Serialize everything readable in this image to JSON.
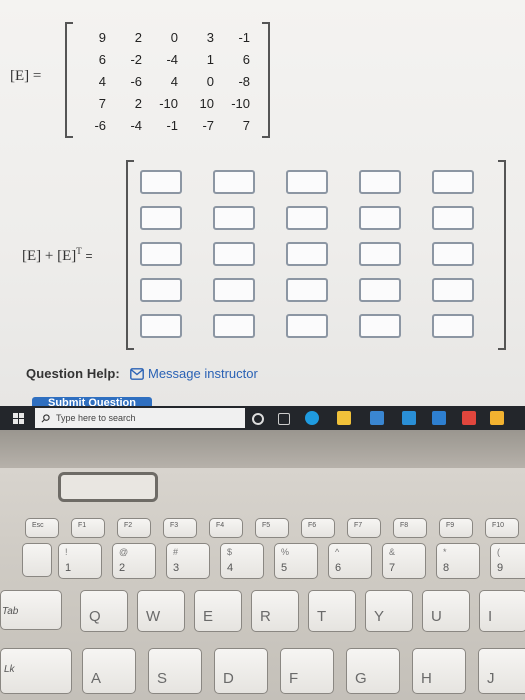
{
  "matrix": {
    "label": "[E] =",
    "rows": [
      [
        "9",
        "2",
        "0",
        "3",
        "-1"
      ],
      [
        "6",
        "-2",
        "-4",
        "1",
        "6"
      ],
      [
        "4",
        "-6",
        "4",
        "0",
        "-8"
      ],
      [
        "7",
        "2",
        "-10",
        "10",
        "-10"
      ],
      [
        "-6",
        "-4",
        "-1",
        "-7",
        "7"
      ]
    ]
  },
  "sum_label": "[E] + [E]",
  "sum_sup": "T",
  "sum_eq": "=",
  "help_label": "Question Help:",
  "message_link": "Message instructor",
  "submit_label": "Submit Question",
  "taskbar": {
    "search_placeholder": "Type here to search"
  },
  "keyboard": {
    "fn_row": [
      "Esc",
      "F1",
      "F2",
      "F3",
      "F4",
      "F5",
      "F6",
      "F7",
      "F8",
      "F9",
      "F10"
    ],
    "num_row": [
      {
        "main": "1",
        "top": "!"
      },
      {
        "main": "2",
        "top": "@"
      },
      {
        "main": "3",
        "top": "#"
      },
      {
        "main": "4",
        "top": "$"
      },
      {
        "main": "5",
        "top": "%"
      },
      {
        "main": "6",
        "top": "^"
      },
      {
        "main": "7",
        "top": "&"
      },
      {
        "main": "8",
        "top": "*"
      },
      {
        "main": "9",
        "top": "("
      }
    ],
    "q_row": [
      "Q",
      "W",
      "E",
      "R",
      "T",
      "Y",
      "U",
      "I"
    ],
    "a_row": [
      "A",
      "S",
      "D",
      "F",
      "G",
      "H",
      "J"
    ],
    "tab_label": "Tab",
    "caps_label": "Lk"
  }
}
